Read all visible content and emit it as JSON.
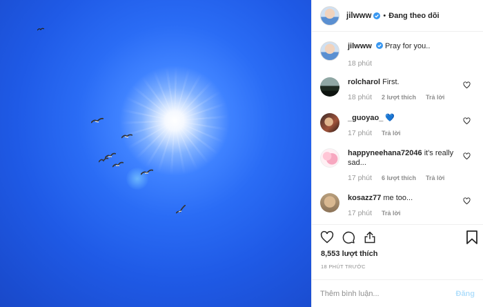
{
  "header": {
    "username": "jilwww",
    "separator": "•",
    "follow_label": "Đang theo dõi"
  },
  "caption": {
    "username": "jilwww",
    "text": "Pray for you..",
    "time": "18 phút"
  },
  "comments": [
    {
      "username": "rolcharol",
      "text": "First.",
      "time": "18 phút",
      "likes": "2 lượt thích",
      "reply": "Trả lời"
    },
    {
      "username": "_guoyao_",
      "text": "💙",
      "time": "17 phút",
      "likes": "",
      "reply": "Trả lời"
    },
    {
      "username": "happyneehana72046",
      "text": "it's really sad...",
      "time": "17 phút",
      "likes": "6 lượt thích",
      "reply": "Trả lời"
    },
    {
      "username": "kosazz77",
      "text": "me too...",
      "time": "17 phút",
      "likes": "",
      "reply": "Trả lời"
    }
  ],
  "post": {
    "likes_count": "8,553 lượt thích",
    "time": "18 PHÚT TRƯỚC"
  },
  "comment_box": {
    "placeholder": "Thêm bình luận...",
    "post_label": "Đăng"
  },
  "colors": {
    "verified": "#3897f0",
    "post_button_disabled": "#b2dffc",
    "sky": "#1f5ae6"
  },
  "icons": [
    "verified-icon",
    "heart-icon",
    "comment-icon",
    "share-icon",
    "bookmark-icon"
  ]
}
